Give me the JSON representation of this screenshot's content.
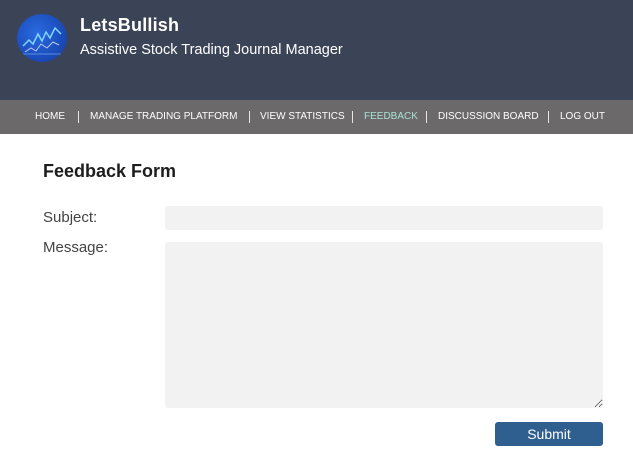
{
  "header": {
    "title": "LetsBullish",
    "subtitle": "Assistive Stock Trading Journal Manager",
    "logo_icon": "stock-chart-logo-icon",
    "background_color": "#3b4356"
  },
  "nav": {
    "background_color": "#6b6969",
    "active_color": "#a9e0d6",
    "items": [
      {
        "label": "HOME"
      },
      {
        "label": "MANAGE TRADING PLATFORM"
      },
      {
        "label": "VIEW STATISTICS"
      },
      {
        "label": "FEEDBACK",
        "active": true
      },
      {
        "label": "DISCUSSION BOARD"
      },
      {
        "label": "LOG OUT"
      }
    ]
  },
  "form": {
    "title": "Feedback Form",
    "subject_label": "Subject:",
    "subject_value": "",
    "message_label": "Message:",
    "message_value": "",
    "submit_label": "Submit",
    "submit_color": "#2f5f8e"
  }
}
